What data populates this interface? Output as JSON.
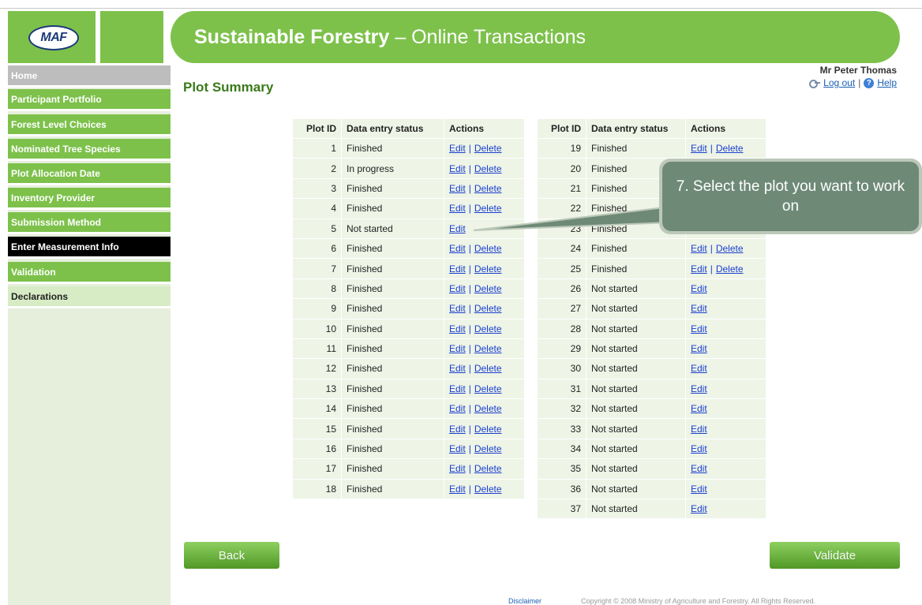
{
  "header": {
    "logo_text": "MAF",
    "title_bold": "Sustainable Forestry",
    "title_rest": " – Online Transactions"
  },
  "sidebar": {
    "items": [
      {
        "label": "Home"
      },
      {
        "label": "Participant Portfolio"
      },
      {
        "label": "Forest Level Choices"
      },
      {
        "label": "Nominated Tree Species"
      },
      {
        "label": "Plot Allocation Date"
      },
      {
        "label": "Inventory Provider"
      },
      {
        "label": "Submission Method"
      },
      {
        "label": "Enter Measurement Info"
      },
      {
        "label": "Validation"
      },
      {
        "label": "Declarations"
      }
    ]
  },
  "page": {
    "title": "Plot Summary"
  },
  "user": {
    "name": "Mr Peter Thomas",
    "logout_label": "Log out",
    "separator": "|",
    "help_label": "Help"
  },
  "table": {
    "headers": [
      "Plot ID",
      "Data entry status",
      "Actions"
    ],
    "edit_label": "Edit",
    "delete_label": "Delete",
    "action_sep": "|",
    "left_rows": [
      {
        "id": "1",
        "status": "Finished",
        "can_delete": true
      },
      {
        "id": "2",
        "status": "In progress",
        "can_delete": true
      },
      {
        "id": "3",
        "status": "Finished",
        "can_delete": true
      },
      {
        "id": "4",
        "status": "Finished",
        "can_delete": true
      },
      {
        "id": "5",
        "status": "Not started",
        "can_delete": false
      },
      {
        "id": "6",
        "status": "Finished",
        "can_delete": true
      },
      {
        "id": "7",
        "status": "Finished",
        "can_delete": true
      },
      {
        "id": "8",
        "status": "Finished",
        "can_delete": true
      },
      {
        "id": "9",
        "status": "Finished",
        "can_delete": true
      },
      {
        "id": "10",
        "status": "Finished",
        "can_delete": true
      },
      {
        "id": "11",
        "status": "Finished",
        "can_delete": true
      },
      {
        "id": "12",
        "status": "Finished",
        "can_delete": true
      },
      {
        "id": "13",
        "status": "Finished",
        "can_delete": true
      },
      {
        "id": "14",
        "status": "Finished",
        "can_delete": true
      },
      {
        "id": "15",
        "status": "Finished",
        "can_delete": true
      },
      {
        "id": "16",
        "status": "Finished",
        "can_delete": true
      },
      {
        "id": "17",
        "status": "Finished",
        "can_delete": true
      },
      {
        "id": "18",
        "status": "Finished",
        "can_delete": true
      }
    ],
    "right_rows": [
      {
        "id": "19",
        "status": "Finished",
        "can_delete": true
      },
      {
        "id": "20",
        "status": "Finished",
        "can_delete": true
      },
      {
        "id": "21",
        "status": "Finished",
        "can_delete": true
      },
      {
        "id": "22",
        "status": "Finished",
        "can_delete": true
      },
      {
        "id": "23",
        "status": "Finished",
        "can_delete": true
      },
      {
        "id": "24",
        "status": "Finished",
        "can_delete": true
      },
      {
        "id": "25",
        "status": "Finished",
        "can_delete": true
      },
      {
        "id": "26",
        "status": "Not started",
        "can_delete": false
      },
      {
        "id": "27",
        "status": "Not started",
        "can_delete": false
      },
      {
        "id": "28",
        "status": "Not started",
        "can_delete": false
      },
      {
        "id": "29",
        "status": "Not started",
        "can_delete": false
      },
      {
        "id": "30",
        "status": "Not started",
        "can_delete": false
      },
      {
        "id": "31",
        "status": "Not started",
        "can_delete": false
      },
      {
        "id": "32",
        "status": "Not started",
        "can_delete": false
      },
      {
        "id": "33",
        "status": "Not started",
        "can_delete": false
      },
      {
        "id": "34",
        "status": "Not started",
        "can_delete": false
      },
      {
        "id": "35",
        "status": "Not started",
        "can_delete": false
      },
      {
        "id": "36",
        "status": "Not started",
        "can_delete": false
      },
      {
        "id": "37",
        "status": "Not started",
        "can_delete": false
      }
    ]
  },
  "callout": {
    "text": "7. Select the plot you want to work on"
  },
  "buttons": {
    "back_label": "Back",
    "validate_label": "Validate"
  },
  "footer": {
    "disclaimer": "Disclaimer",
    "copyright": "Copyright © 2008 Ministry of Agriculture and Forestry. All Rights Reserved."
  },
  "colors": {
    "brand_green": "#7dc14b",
    "active_nav": "#000000",
    "link_blue": "#1a3fd0",
    "callout_fill": "#6e8a77"
  },
  "icons": [
    "key-icon",
    "help-icon"
  ]
}
